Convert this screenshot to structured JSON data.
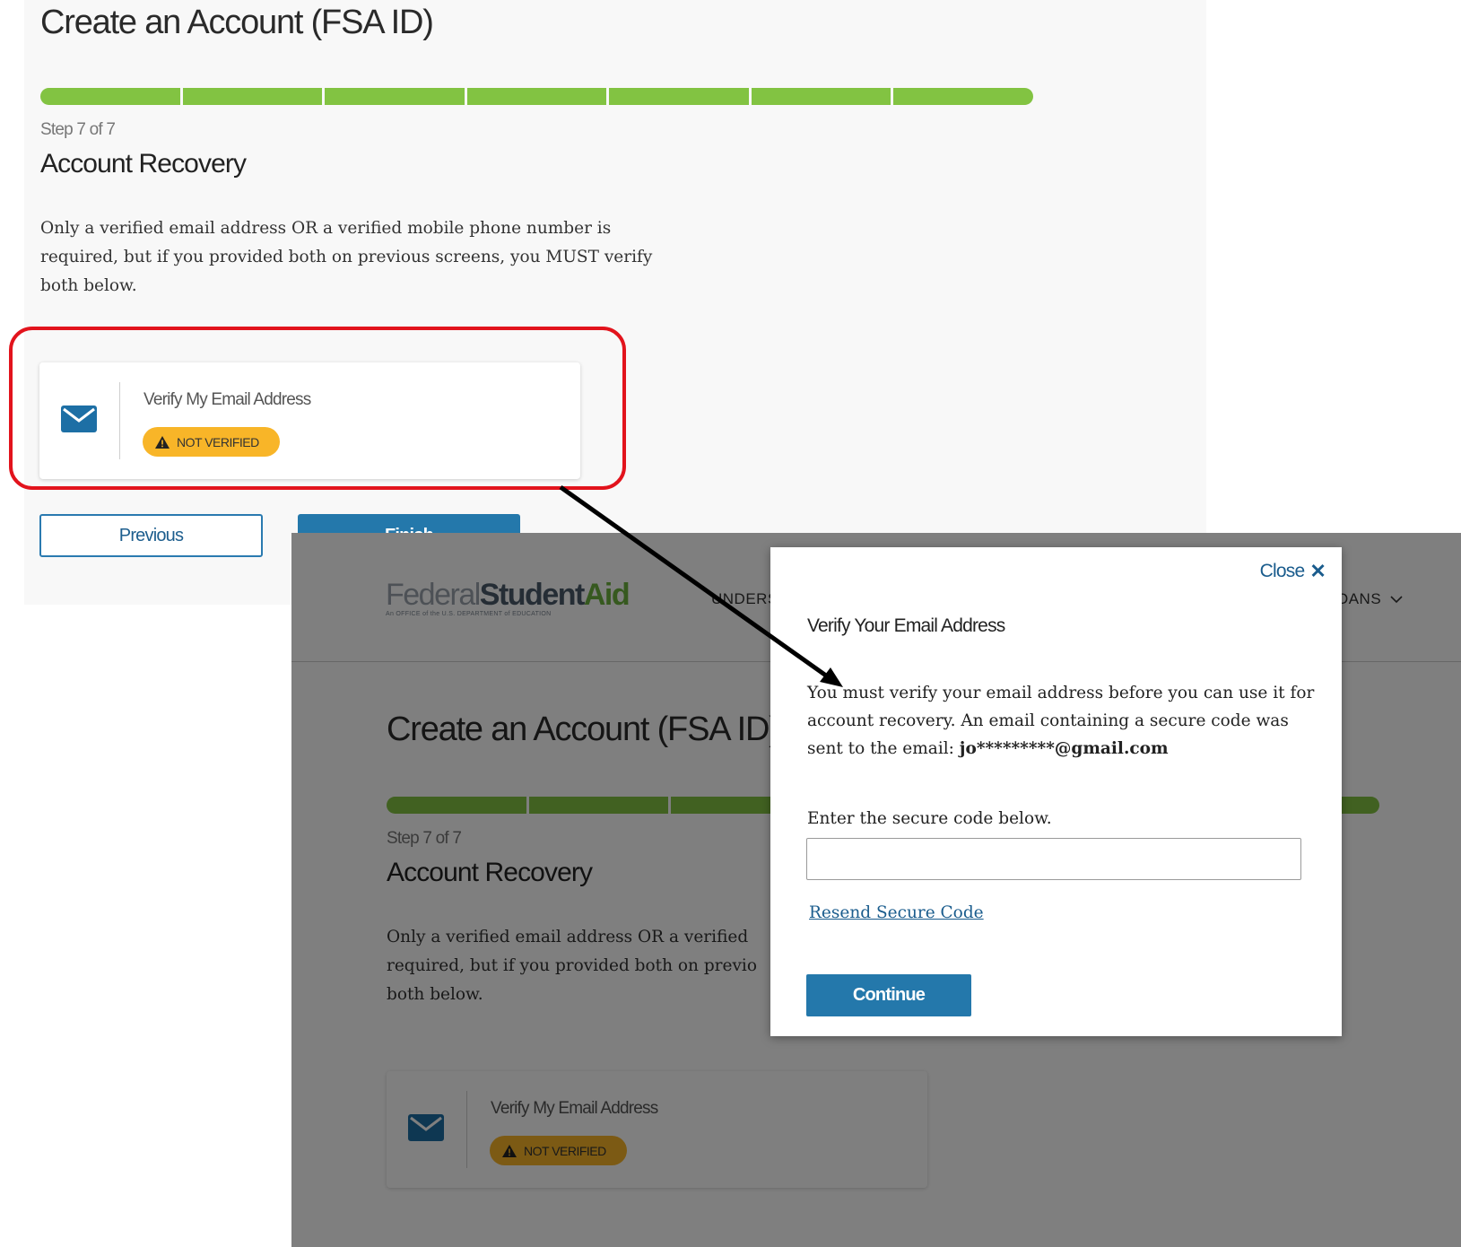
{
  "top": {
    "page_title": "Create an Account (FSA ID)",
    "progress_segments": 7,
    "progress_color": "#82c342",
    "step_label": "Step 7 of 7",
    "section_title": "Account Recovery",
    "intro_text": "Only a verified email address OR a verified mobile phone number is required, but if you provided both on previous screens, you MUST verify both below.",
    "card": {
      "icon": "envelope-icon",
      "label": "Verify My Email Address",
      "badge": "NOT VERIFIED",
      "badge_icon": "warning-icon"
    },
    "buttons": {
      "previous": "Previous",
      "finish": "Finish"
    },
    "highlight_color": "#e2131c"
  },
  "bottom": {
    "logo": {
      "federal": "Federal",
      "student": "Student",
      "aid": "Aid",
      "subtitle": "An OFFICE of the U.S. DEPARTMENT of EDUCATION"
    },
    "nav": {
      "understand_fragment": "UNDERST",
      "loans_fragment": "OANS"
    },
    "page_title": "Create an Account (FSA ID)",
    "step_label": "Step 7 of 7",
    "section_title": "Account Recovery",
    "intro_line1": "Only a verified email address OR a verified",
    "intro_line2": "required, but if you provided both on previo",
    "intro_line3": "both below.",
    "card": {
      "label": "Verify My Email Address",
      "badge": "NOT VERIFIED"
    }
  },
  "modal": {
    "close_label": "Close",
    "title": "Verify Your Email Address",
    "text_prefix": "You must verify your email address before you can use it for account recovery. An email containing a secure code was sent to the email: ",
    "email_masked": "jo*********@gmail.com",
    "code_label": "Enter the secure code below.",
    "code_value": "",
    "resend_link": "Resend Secure Code",
    "continue_button": "Continue"
  }
}
